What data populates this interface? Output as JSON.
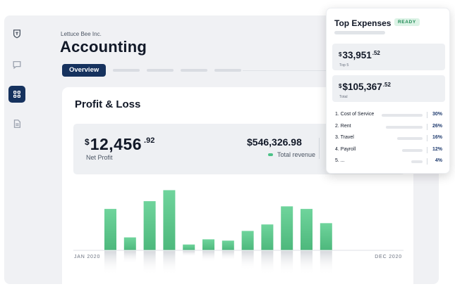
{
  "header": {
    "company": "Lettuce Bee Inc.",
    "title": "Accounting"
  },
  "tabs": {
    "active_label": "Overview"
  },
  "sidebar": {
    "items": [
      {
        "icon": "shield-logo-icon",
        "active": false
      },
      {
        "icon": "chat-icon",
        "active": false
      },
      {
        "icon": "grid-icon",
        "active": true
      },
      {
        "icon": "document-icon",
        "active": false
      }
    ]
  },
  "profit_loss": {
    "title": "Profit & Loss",
    "net_profit": {
      "currency": "$",
      "integer": "12,456",
      "decimal": ".92",
      "label": "Net Profit"
    },
    "total_revenue": {
      "value": "$546,326.98",
      "label": "Total revenue"
    },
    "accent_color": "#4cc287"
  },
  "chart_data": {
    "type": "bar",
    "xlabel_start": "JAN 2020",
    "xlabel_end": "DEC 2020",
    "values": [
      64,
      20,
      76,
      93,
      9,
      17,
      15,
      30,
      40,
      68,
      64,
      42
    ],
    "color": "#5fc98f"
  },
  "top_expenses": {
    "title": "Top Expenses",
    "status": "READY",
    "top5": {
      "currency": "$",
      "integer": "33,951",
      "decimal": ".52",
      "label": "Top 5"
    },
    "total": {
      "currency": "$",
      "integer": "$105,367",
      "decimal": ".52",
      "label": "Total"
    },
    "items": [
      {
        "name": "1. Cost of Service",
        "pct": "30%",
        "share": 30
      },
      {
        "name": "2. Rent",
        "pct": "26%",
        "share": 26
      },
      {
        "name": "3. Travel",
        "pct": "16%",
        "share": 16
      },
      {
        "name": "4. Payroll",
        "pct": "12%",
        "share": 12
      },
      {
        "name": "5. ...",
        "pct": "4%",
        "share": 4
      }
    ]
  }
}
